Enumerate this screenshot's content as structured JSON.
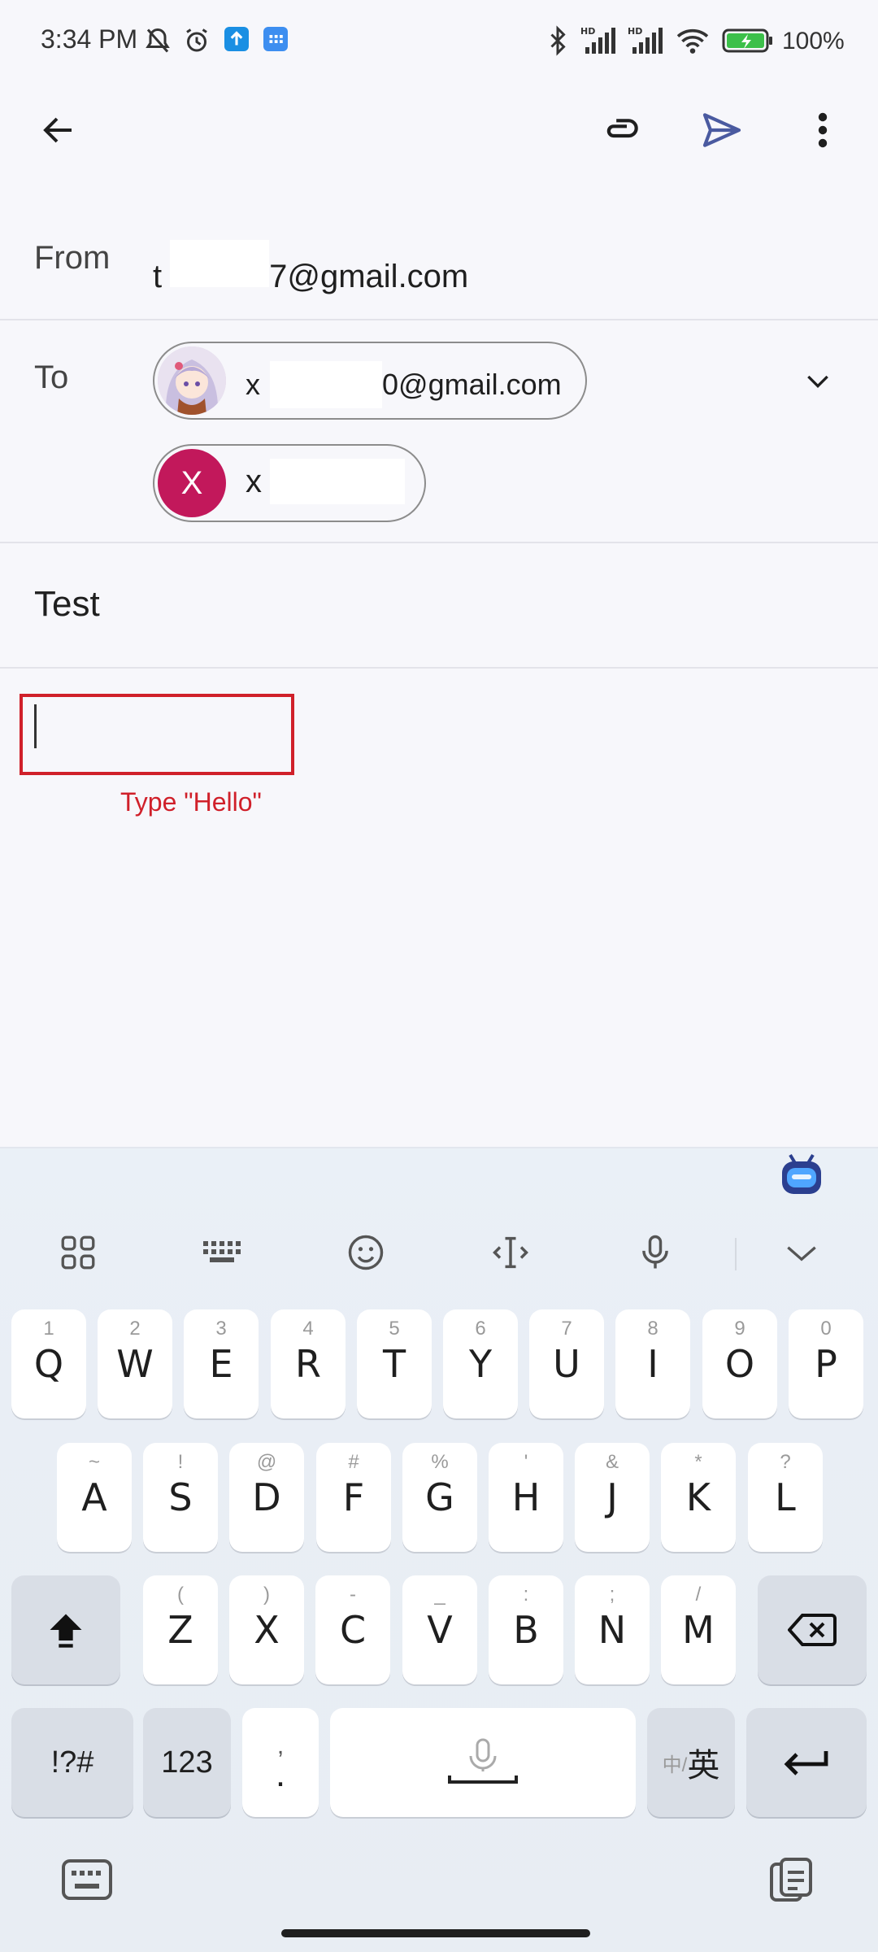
{
  "status_bar": {
    "time": "3:34 PM",
    "battery": "100%",
    "icons": [
      "silent-bell-icon",
      "alarm-icon",
      "upload-icon",
      "app-grid-icon",
      "bluetooth-icon",
      "signal-hd-icon",
      "signal-hd-icon",
      "wifi-icon",
      "battery-charging-icon"
    ]
  },
  "app_bar": {
    "icons": [
      "back-arrow-icon",
      "attach-icon",
      "send-icon",
      "more-vert-icon"
    ]
  },
  "compose": {
    "from_label": "From",
    "from_prefix": "t",
    "from_suffix": "7@gmail.com",
    "to_label": "To",
    "recipients": [
      {
        "prefix": "x",
        "suffix": "0@gmail.com",
        "avatar": "anime-avatar"
      },
      {
        "prefix": "x",
        "suffix": "",
        "avatar_letter": "X",
        "avatar_color": "#c2185b"
      }
    ],
    "subject": "Test",
    "body_value": "",
    "annotation": "Type \"Hello\""
  },
  "keyboard": {
    "toolbar": [
      "apps-grid-icon",
      "keyboard-layout-icon",
      "emoji-icon",
      "cursor-icon",
      "mic-icon",
      "collapse-icon"
    ],
    "row1": [
      {
        "main": "Q",
        "sub": "1"
      },
      {
        "main": "W",
        "sub": "2"
      },
      {
        "main": "E",
        "sub": "3"
      },
      {
        "main": "R",
        "sub": "4"
      },
      {
        "main": "T",
        "sub": "5"
      },
      {
        "main": "Y",
        "sub": "6"
      },
      {
        "main": "U",
        "sub": "7"
      },
      {
        "main": "I",
        "sub": "8"
      },
      {
        "main": "O",
        "sub": "9"
      },
      {
        "main": "P",
        "sub": "0"
      }
    ],
    "row2": [
      {
        "main": "A",
        "sub": "~"
      },
      {
        "main": "S",
        "sub": "!"
      },
      {
        "main": "D",
        "sub": "@"
      },
      {
        "main": "F",
        "sub": "#"
      },
      {
        "main": "G",
        "sub": "%"
      },
      {
        "main": "H",
        "sub": "'"
      },
      {
        "main": "J",
        "sub": "&"
      },
      {
        "main": "K",
        "sub": "*"
      },
      {
        "main": "L",
        "sub": "?"
      }
    ],
    "row3": [
      {
        "main": "Z",
        "sub": "("
      },
      {
        "main": "X",
        "sub": ")"
      },
      {
        "main": "C",
        "sub": "-"
      },
      {
        "main": "V",
        "sub": "_"
      },
      {
        "main": "B",
        "sub": ":"
      },
      {
        "main": "N",
        "sub": ";"
      },
      {
        "main": "M",
        "sub": "/"
      }
    ],
    "symbols_label": "!?#",
    "numbers_label": "123",
    "comma_sub": ",",
    "comma_main": ".",
    "lang_small": "中/",
    "lang_big": "英",
    "accent_color": "#d0202a"
  }
}
